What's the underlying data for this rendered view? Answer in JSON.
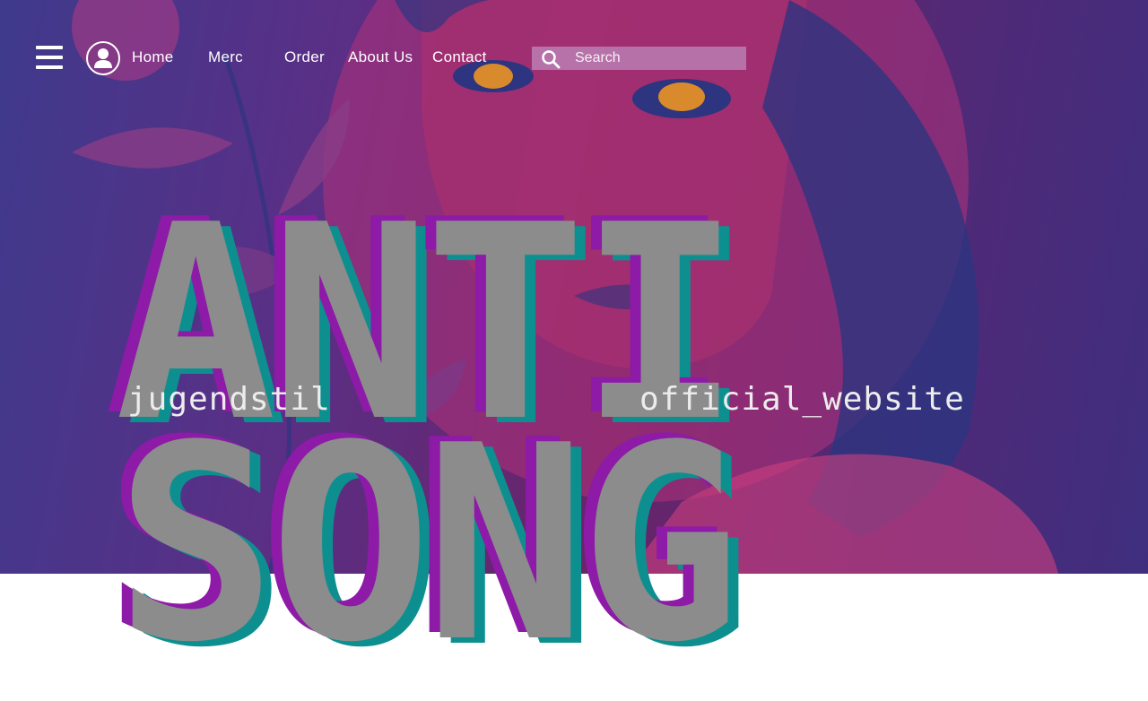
{
  "nav": {
    "menu_icon": "hamburger-menu-icon",
    "account_icon": "user-account-icon",
    "links": [
      "Home",
      "Merc",
      "Order",
      "About Us",
      "Contact"
    ]
  },
  "search": {
    "placeholder": "Search",
    "icon": "search-icon"
  },
  "hero": {
    "line1": "ANTI",
    "line2": "SONG",
    "left_caption": "jugendstil",
    "right_caption": "official_website"
  },
  "colors": {
    "text_fill": "#8c8c8c",
    "shadow_magenta": "#8e1aa8",
    "shadow_teal": "#0e8f8f",
    "background_purple": "#5a2f86"
  }
}
